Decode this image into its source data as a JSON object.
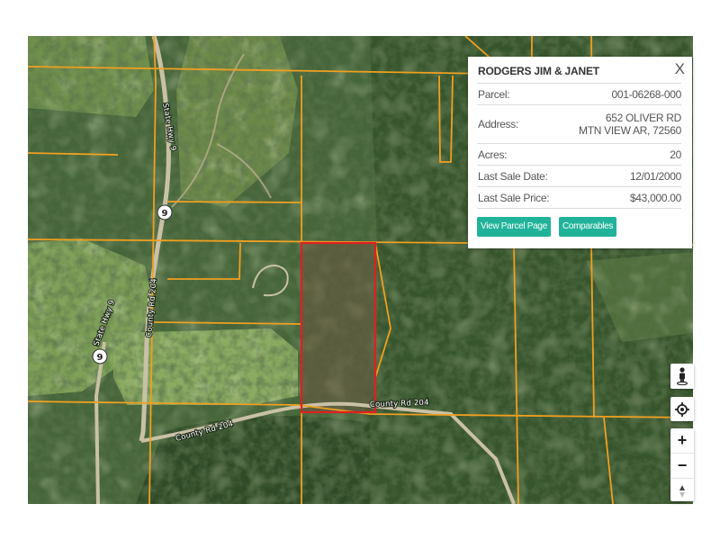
{
  "map": {
    "road_labels": {
      "state_hwy_north": "State Hwy 9",
      "state_hwy_west": "State Hwy 9",
      "county_rd_vertical": "County Rd 204",
      "county_rd_east": "County Rd 204",
      "county_rd_south": "County Rd 204"
    },
    "shields": {
      "hwy_north": "9",
      "hwy_west": "9"
    },
    "colors": {
      "parcel_line": "#f0a020",
      "selected_parcel": "#e02020",
      "road": "#c9c1a6",
      "forest": "#3c5a2c",
      "pasture": "#8bab62"
    }
  },
  "popup": {
    "owner": "RODGERS JIM & JANET",
    "close": "X",
    "rows": [
      {
        "key": "Parcel:",
        "value": "001-06268-000"
      },
      {
        "key": "Address:",
        "value_line1": "652 OLIVER RD",
        "value_line2": "MTN VIEW AR, 72560"
      },
      {
        "key": "Acres:",
        "value": "20"
      },
      {
        "key": "Last Sale Date:",
        "value": "12/01/2000"
      },
      {
        "key": "Last Sale Price:",
        "value": "$43,000.00"
      }
    ],
    "buttons": {
      "view_parcel": "View Parcel Page",
      "comparables": "Comparables"
    }
  },
  "controls": {
    "zoom_in": "+",
    "zoom_out": "−"
  }
}
